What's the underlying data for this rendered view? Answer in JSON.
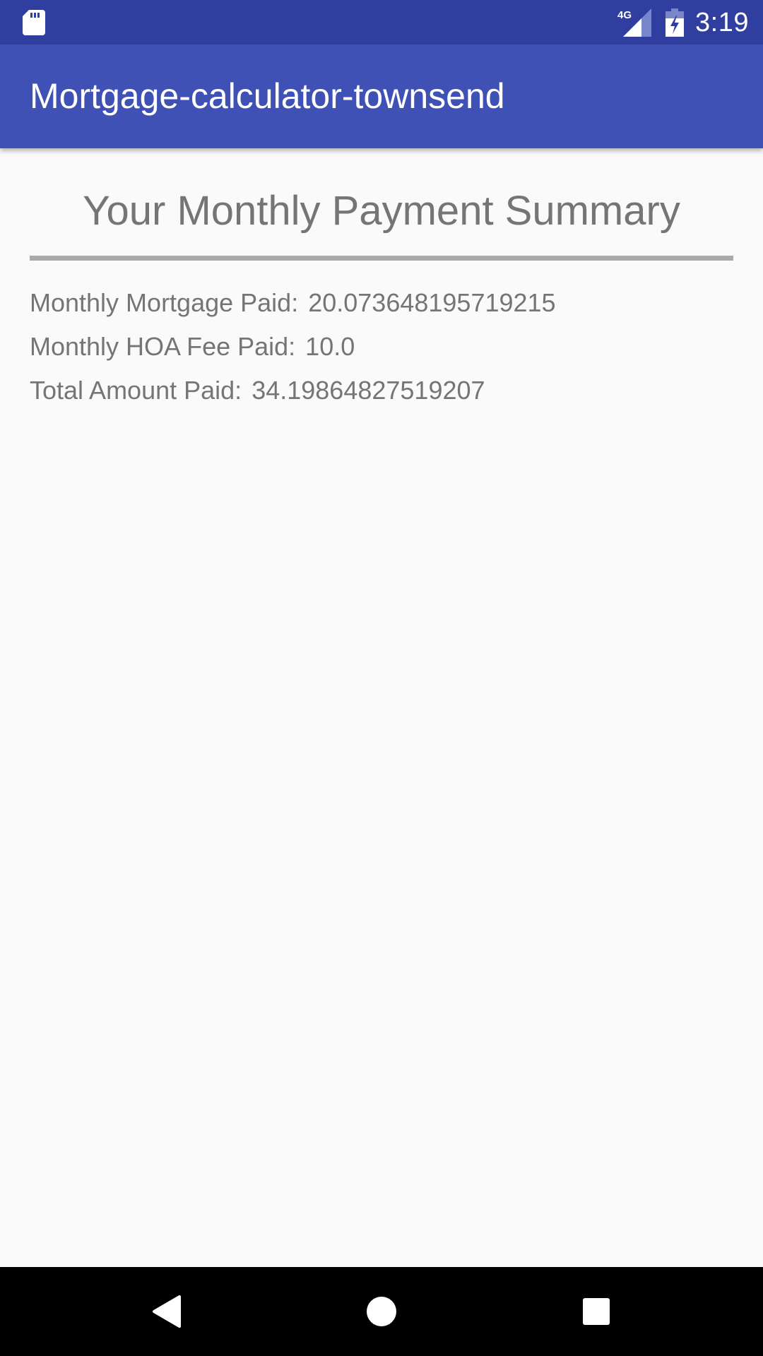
{
  "status_bar": {
    "time": "3:19",
    "network_label": "4G",
    "icons": [
      "sd-card-icon",
      "signal-4g-icon",
      "battery-charging-icon"
    ]
  },
  "app_bar": {
    "title": "Mortgage-calculator-townsend"
  },
  "summary": {
    "heading": "Your Monthly Payment Summary",
    "rows": [
      {
        "label": "Monthly Mortgage Paid:",
        "value": "20.073648195719215"
      },
      {
        "label": "Monthly HOA Fee Paid:",
        "value": "10.0"
      },
      {
        "label": "Total Amount Paid:",
        "value": "34.19864827519207"
      }
    ]
  },
  "nav_bar": {
    "icons": [
      "back-icon",
      "home-icon",
      "recents-icon"
    ]
  },
  "colors": {
    "status_bar": "#303f9f",
    "app_bar": "#3f51b5",
    "text": "#757575",
    "divider": "#aaaaaa",
    "background": "#fafafa"
  }
}
